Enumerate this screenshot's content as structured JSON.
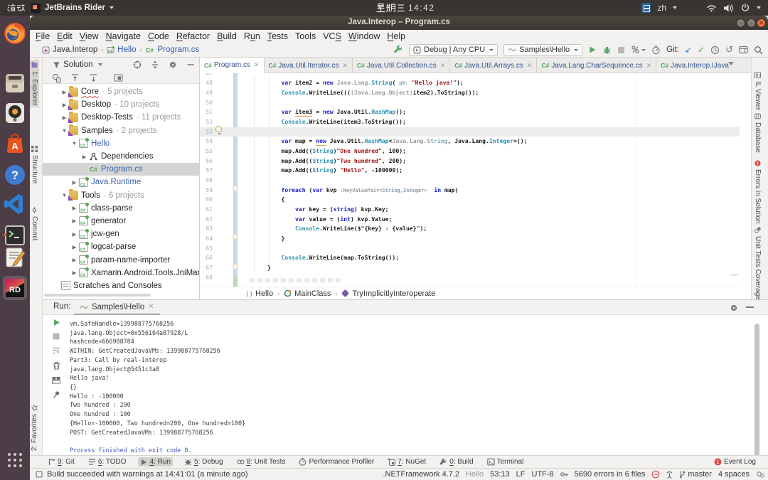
{
  "gnome_bar": {
    "activities": "活动",
    "app_menu": "JetBrains Rider",
    "clock_weekday": "星期三",
    "clock_time": "14:42",
    "input_method": "zh"
  },
  "titlebar": {
    "title": "Java.Interop – Program.cs"
  },
  "menubar": {
    "items": [
      {
        "label": "File",
        "u": 0
      },
      {
        "label": "Edit",
        "u": 0
      },
      {
        "label": "View",
        "u": 0
      },
      {
        "label": "Navigate",
        "u": 0
      },
      {
        "label": "Code",
        "u": 0
      },
      {
        "label": "Refactor",
        "u": 0
      },
      {
        "label": "Build",
        "u": 0
      },
      {
        "label": "Run",
        "u": 1
      },
      {
        "label": "Tests",
        "u": 0
      },
      {
        "label": "Tools",
        "u": -1
      },
      {
        "label": "VCS",
        "u": 2
      },
      {
        "label": "Window",
        "u": 0
      },
      {
        "label": "Help",
        "u": 0
      }
    ]
  },
  "navbar": {
    "crumbs": [
      {
        "label": "Java.Interop",
        "icon": "solution",
        "blue": false
      },
      {
        "label": "Hello",
        "icon": "project",
        "blue": true
      },
      {
        "label": "Program.cs",
        "icon": "cs",
        "blue": true
      }
    ],
    "run_config": "Debug | Any CPU",
    "run_target": "Samples\\Hello",
    "git_label": "Git:"
  },
  "left_stripe": {
    "explorer": "1: Explorer",
    "structure": "Structure",
    "commit": "Commit",
    "favorites": "2: Favorites"
  },
  "right_stripe": {
    "il_viewer": "IL Viewer",
    "database": "Database",
    "errors": "Errors in Solution",
    "coverage": "Unit Tests Coverage"
  },
  "project_panel": {
    "header": "Solution",
    "tree": [
      {
        "level": 0,
        "arrow": "r",
        "icon": "slnfolder",
        "label": "Core",
        "suffix": "5 projects",
        "error": true
      },
      {
        "level": 0,
        "arrow": "r",
        "icon": "slnfolder",
        "label": "Desktop",
        "suffix": "10 projects"
      },
      {
        "level": 0,
        "arrow": "r",
        "icon": "slnfolder",
        "label": "Desktop-Tests",
        "suffix": "11 projects"
      },
      {
        "level": 0,
        "arrow": "d",
        "icon": "slnfolder",
        "label": "Samples",
        "suffix": "2 projects"
      },
      {
        "level": 1,
        "arrow": "d",
        "icon": "project",
        "label": "Hello",
        "blue": true
      },
      {
        "level": 2,
        "arrow": "r",
        "icon": "deps",
        "label": "Dependencies"
      },
      {
        "level": 2,
        "arrow": null,
        "icon": "cs",
        "label": "Program.cs",
        "blue": true,
        "selected": true
      },
      {
        "level": 1,
        "arrow": "r",
        "icon": "project",
        "label": "Java.Runtime",
        "blue": true
      },
      {
        "level": 0,
        "arrow": "d",
        "icon": "slnfolder",
        "label": "Tools",
        "suffix": "6 projects"
      },
      {
        "level": 1,
        "arrow": "r",
        "icon": "project",
        "label": "class-parse"
      },
      {
        "level": 1,
        "arrow": "r",
        "icon": "project",
        "label": "generator"
      },
      {
        "level": 1,
        "arrow": "r",
        "icon": "project",
        "label": "jcw-gen"
      },
      {
        "level": 1,
        "arrow": "r",
        "icon": "project",
        "label": "logcat-parse"
      },
      {
        "level": 1,
        "arrow": "r",
        "icon": "project",
        "label": "param-name-importer"
      },
      {
        "level": 1,
        "arrow": "r",
        "icon": "project",
        "label": "Xamarin.Android.Tools.JniMarshalMethods"
      },
      {
        "level": 0,
        "arrow": null,
        "icon": "scratch",
        "label": "Scratches and Consoles"
      }
    ]
  },
  "editor": {
    "tabs": [
      {
        "label": "Program.cs",
        "active": true
      },
      {
        "label": "Java.Util.Iterator.cs"
      },
      {
        "label": "Java.Util.Collection.cs"
      },
      {
        "label": "Java.Util.Arrays.cs"
      },
      {
        "label": "Java.Lang.CharSequence.cs"
      },
      {
        "label": "Java.Interop.IJava",
        "last": true
      }
    ],
    "lines": [
      {
        "num": 47,
        "tokens": []
      },
      {
        "num": 48,
        "tokens": [
          [
            "p",
            "            "
          ],
          [
            "kw",
            "var"
          ],
          [
            "p",
            " item2 = "
          ],
          [
            "kw",
            "new"
          ],
          [
            "p",
            " "
          ],
          [
            "dim",
            "Java.Lang."
          ],
          [
            "type",
            "String"
          ],
          [
            "p",
            "( "
          ],
          [
            "hint",
            "p0:"
          ],
          [
            "p",
            " "
          ],
          [
            "str",
            "\"Hello java!\""
          ],
          [
            "p",
            ");"
          ]
        ]
      },
      {
        "num": 49,
        "tokens": [
          [
            "p",
            "            "
          ],
          [
            "type",
            "Console"
          ],
          [
            "p",
            ".WriteLine((("
          ],
          [
            "dim",
            "(Java.Lang.Object)"
          ],
          [
            "p",
            "item2).ToString());"
          ]
        ]
      },
      {
        "num": 50,
        "tokens": []
      },
      {
        "num": 51,
        "tokens": [
          [
            "p",
            "            "
          ],
          [
            "kw",
            "var"
          ],
          [
            "p",
            " "
          ],
          [
            "warn",
            "item3"
          ],
          [
            "p",
            " = "
          ],
          [
            "kw",
            "new"
          ],
          [
            "p",
            " Java.Util."
          ],
          [
            "type",
            "HashMap"
          ],
          [
            "p",
            "();"
          ]
        ]
      },
      {
        "num": 52,
        "tokens": [
          [
            "p",
            "            "
          ],
          [
            "type",
            "Console"
          ],
          [
            "p",
            ".WriteLine(item3.ToString());"
          ]
        ]
      },
      {
        "num": 53,
        "caret": true,
        "tokens": []
      },
      {
        "num": 54,
        "tokens": [
          [
            "p",
            "            "
          ],
          [
            "kw",
            "var"
          ],
          [
            "p",
            " map = "
          ],
          [
            "kwwarn",
            "new"
          ],
          [
            "p",
            " Java.Util."
          ],
          [
            "type",
            "HashMap"
          ],
          [
            "p",
            "<"
          ],
          [
            "dim",
            "Java.Lang."
          ],
          [
            "dimtype",
            "String"
          ],
          [
            "p",
            ", Java.Lang."
          ],
          [
            "type",
            "Integer"
          ],
          [
            "p",
            ">();"
          ]
        ]
      },
      {
        "num": 55,
        "tokens": [
          [
            "p",
            "            map.Add(("
          ],
          [
            "type",
            "String"
          ],
          [
            "p",
            ")"
          ],
          [
            "str",
            "\"One hundred\""
          ],
          [
            "p",
            ", 100);"
          ]
        ]
      },
      {
        "num": 56,
        "tokens": [
          [
            "p",
            "            map.Add(("
          ],
          [
            "type",
            "String"
          ],
          [
            "p",
            ")"
          ],
          [
            "str",
            "\"Two hundred\""
          ],
          [
            "p",
            ", 200);"
          ]
        ]
      },
      {
        "num": 57,
        "tokens": [
          [
            "p",
            "            map.Add(("
          ],
          [
            "type",
            "String"
          ],
          [
            "p",
            ") "
          ],
          [
            "str",
            "\"Hello\""
          ],
          [
            "p",
            ", -100000);"
          ]
        ]
      },
      {
        "num": 58,
        "tokens": []
      },
      {
        "num": 59,
        "tokens": [
          [
            "p",
            "            "
          ],
          [
            "kw",
            "foreach"
          ],
          [
            "p",
            " ("
          ],
          [
            "kw",
            "var"
          ],
          [
            "p",
            " kvp "
          ],
          [
            "hint",
            ":KeyValuePair<String,Integer>"
          ],
          [
            "p",
            "  "
          ],
          [
            "kw",
            "in"
          ],
          [
            "p",
            " map)"
          ]
        ]
      },
      {
        "num": 60,
        "tokens": [
          [
            "p",
            "            {"
          ]
        ]
      },
      {
        "num": 61,
        "tokens": [
          [
            "p",
            "                "
          ],
          [
            "kw",
            "var"
          ],
          [
            "p",
            " key = ("
          ],
          [
            "kw",
            "string"
          ],
          [
            "p",
            ") kvp.Key;"
          ]
        ]
      },
      {
        "num": 62,
        "tokens": [
          [
            "p",
            "                "
          ],
          [
            "kw",
            "var"
          ],
          [
            "p",
            " value = ("
          ],
          [
            "kw",
            "int"
          ],
          [
            "p",
            ") kvp.Value;"
          ]
        ]
      },
      {
        "num": 63,
        "tokens": [
          [
            "p",
            "                "
          ],
          [
            "type",
            "Console"
          ],
          [
            "p",
            ".WriteLine($"
          ],
          [
            "str",
            "\""
          ],
          [
            "p",
            "{key}"
          ],
          [
            "str",
            " : "
          ],
          [
            "p",
            "{value}"
          ],
          [
            "str",
            "\""
          ],
          [
            "p",
            ");"
          ]
        ]
      },
      {
        "num": 64,
        "tokens": [
          [
            "p",
            "            }"
          ]
        ]
      },
      {
        "num": 65,
        "tokens": []
      },
      {
        "num": 66,
        "tokens": [
          [
            "p",
            "            "
          ],
          [
            "type",
            "Console"
          ],
          [
            "p",
            ".WriteLine(map.ToString());"
          ]
        ]
      },
      {
        "num": 67,
        "tokens": [
          [
            "p",
            "        }"
          ]
        ]
      },
      {
        "num": 68,
        "tokens": []
      }
    ],
    "breadcrumbs": [
      {
        "label": "Hello",
        "icon": "ns"
      },
      {
        "label": "MainClass",
        "icon": "class"
      },
      {
        "label": "TryImplicitlyInteroperate",
        "icon": "method"
      }
    ]
  },
  "run_panel": {
    "label": "Run:",
    "tab": "Samples\\Hello",
    "console": [
      "vm.SafeHandle=139988775768256",
      "java.lang.Object=0x556164a87928/L",
      "hashcode=666988784",
      "WITHIN: GetCreatedJavaVMs: 139988775768256",
      "Part3: Call by real-interop",
      "java.lang.Object@5451c3a8",
      "Hello java!",
      "{}",
      "Hello : -100000",
      "Two hundred : 200",
      "One hundred : 100",
      "{Hello=-100000, Two hundred=200, One hundred=100}",
      "POST: GetCreatedJavaVMs: 139988775768256",
      ""
    ],
    "final_line": "Process finished with exit code 0."
  },
  "bottom_bar": {
    "items": [
      {
        "label": "9: Git",
        "u": 0,
        "icon": "git"
      },
      {
        "label": "6: TODO",
        "u": 0,
        "icon": "todo"
      },
      {
        "label": "4: Run",
        "u": 0,
        "icon": "run",
        "selected": true
      },
      {
        "label": "5: Debug",
        "u": 0,
        "icon": "debug"
      },
      {
        "label": "8: Unit Tests",
        "u": 0,
        "icon": "tests"
      },
      {
        "label": "Performance Profiler",
        "u": -1,
        "icon": "profiler"
      },
      {
        "label": "7: NuGet",
        "u": 0,
        "icon": "nuget"
      },
      {
        "label": "0: Build",
        "u": 0,
        "icon": "build"
      },
      {
        "label": "Terminal",
        "u": -1,
        "icon": "terminal"
      }
    ],
    "event_log": "Event Log"
  },
  "status_bar": {
    "message": "Build succeeded with warnings at 14:41:01 (a minute ago)",
    "framework": ".NETFramework 4.7.2",
    "config": "Hello",
    "caret": "53:13",
    "line_sep": "LF",
    "encoding": "UTF-8",
    "errors": "5690 errors in 6 files",
    "branch": "master",
    "indent": "4 spaces"
  }
}
